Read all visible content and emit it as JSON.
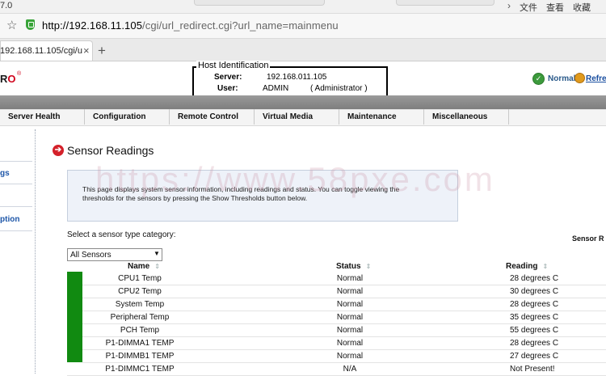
{
  "browser": {
    "version_text": "7.0",
    "menu": [
      "文件",
      "查看",
      "收藏"
    ],
    "url_host": "http://192.168.11.105",
    "url_path": "/cgi/url_redirect.cgi?url_name=mainmenu",
    "tab_title": "192.168.11.105/cgi/u",
    "tab_close": "×",
    "new_tab": "+",
    "menu_arrow": "›"
  },
  "header": {
    "logo": "R",
    "logo_o": "O",
    "logo_reg": "®",
    "host_id_title": "Host Identification",
    "server_label": "Server:",
    "server_value": "192.168.011.105",
    "user_label": "User:",
    "user_value": "ADMIN",
    "user_role": "( Administrator )",
    "status_text": "Normal",
    "refresh_text": "Refresh"
  },
  "nav": [
    "Server Health",
    "Configuration",
    "Remote Control",
    "Virtual Media",
    "Maintenance",
    "Miscellaneous"
  ],
  "sidebar": {
    "items": [
      {
        "label": "gs"
      },
      {
        "label": "ption"
      }
    ]
  },
  "main": {
    "title": "Sensor Readings",
    "description": "This page displays system sensor information, including readings and status. You can toggle viewing the thresholds for the sensors by pressing the Show Thresholds button below.",
    "watermark": "https://www.58pxe.com",
    "category_label": "Select a sensor type category:",
    "sensor_readings_short": "Sensor R",
    "select_value": "All Sensors",
    "columns": {
      "name": "Name",
      "status": "Status",
      "reading": "Reading"
    },
    "sort_glyph": "⇕",
    "rows": [
      {
        "name": "CPU1 Temp",
        "status": "Normal",
        "reading": "28 degrees C",
        "indicator": "#118a11"
      },
      {
        "name": "CPU2 Temp",
        "status": "Normal",
        "reading": "30 degrees C",
        "indicator": "#118a11"
      },
      {
        "name": "System Temp",
        "status": "Normal",
        "reading": "28 degrees C",
        "indicator": "#118a11"
      },
      {
        "name": "Peripheral Temp",
        "status": "Normal",
        "reading": "35 degrees C",
        "indicator": "#118a11"
      },
      {
        "name": "PCH Temp",
        "status": "Normal",
        "reading": "55 degrees C",
        "indicator": "#118a11"
      },
      {
        "name": "P1-DIMMA1 TEMP",
        "status": "Normal",
        "reading": "28 degrees C",
        "indicator": "#118a11"
      },
      {
        "name": "P1-DIMMB1 TEMP",
        "status": "Normal",
        "reading": "27 degrees C",
        "indicator": "#118a11"
      },
      {
        "name": "P1-DIMMC1 TEMP",
        "status": "N/A",
        "reading": "Not Present!",
        "indicator": "#ffffff"
      }
    ]
  },
  "colors": {
    "accent_red": "#d4212a",
    "status_green": "#118a11",
    "link_blue": "#1d56a8"
  }
}
